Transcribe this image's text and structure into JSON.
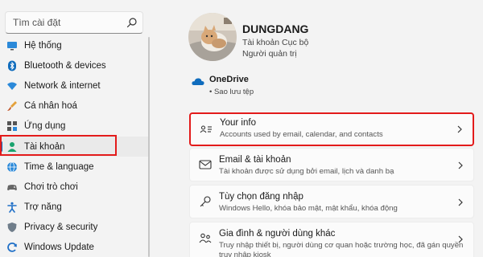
{
  "search": {
    "placeholder": "Tìm cài đặt",
    "icon": "search-icon"
  },
  "sidebar": {
    "items": [
      {
        "label": "Hệ thống",
        "icon": "system-icon"
      },
      {
        "label": "Bluetooth & devices",
        "icon": "bluetooth-icon"
      },
      {
        "label": "Network & internet",
        "icon": "wifi-icon"
      },
      {
        "label": "Cá nhân hoá",
        "icon": "paint-brush-icon"
      },
      {
        "label": "Ứng dụng",
        "icon": "apps-icon"
      },
      {
        "label": "Tài khoản",
        "icon": "person-icon",
        "active": true
      },
      {
        "label": "Time & language",
        "icon": "globe-clock-icon"
      },
      {
        "label": "Chơi trò chơi",
        "icon": "gaming-icon"
      },
      {
        "label": "Trợ năng",
        "icon": "accessibility-icon"
      },
      {
        "label": "Privacy & security",
        "icon": "shield-icon"
      },
      {
        "label": "Windows Update",
        "icon": "windows-update-icon"
      }
    ]
  },
  "user": {
    "name": "DUNGDANG",
    "account_type": "Tài khoản Cục bộ",
    "role": "Người quản trị"
  },
  "onedrive": {
    "title": "OneDrive",
    "status": "Sao lưu tệp"
  },
  "cards": [
    {
      "title": "Your info",
      "desc": "Accounts used by email, calendar, and contacts",
      "icon": "contact-card-icon"
    },
    {
      "title": "Email & tài khoản",
      "desc": "Tài khoản được sử dụng bởi email, lịch và danh bạ",
      "icon": "mail-icon"
    },
    {
      "title": "Tùy chọn đăng nhập",
      "desc": "Windows Hello, khóa bảo mật, mật khẩu, khóa động",
      "icon": "key-icon"
    },
    {
      "title": "Gia đình & người dùng khác",
      "desc": "Truy nhập thiết bị, người dùng cơ quan hoặc trường học, đã gán quyền",
      "desc2": "truy nhập kiosk",
      "icon": "family-icon"
    }
  ],
  "colors": {
    "accent": "#0067c0",
    "highlight": "#e31b1b",
    "background": "#f3f3f3",
    "card": "#fbfbfb"
  }
}
